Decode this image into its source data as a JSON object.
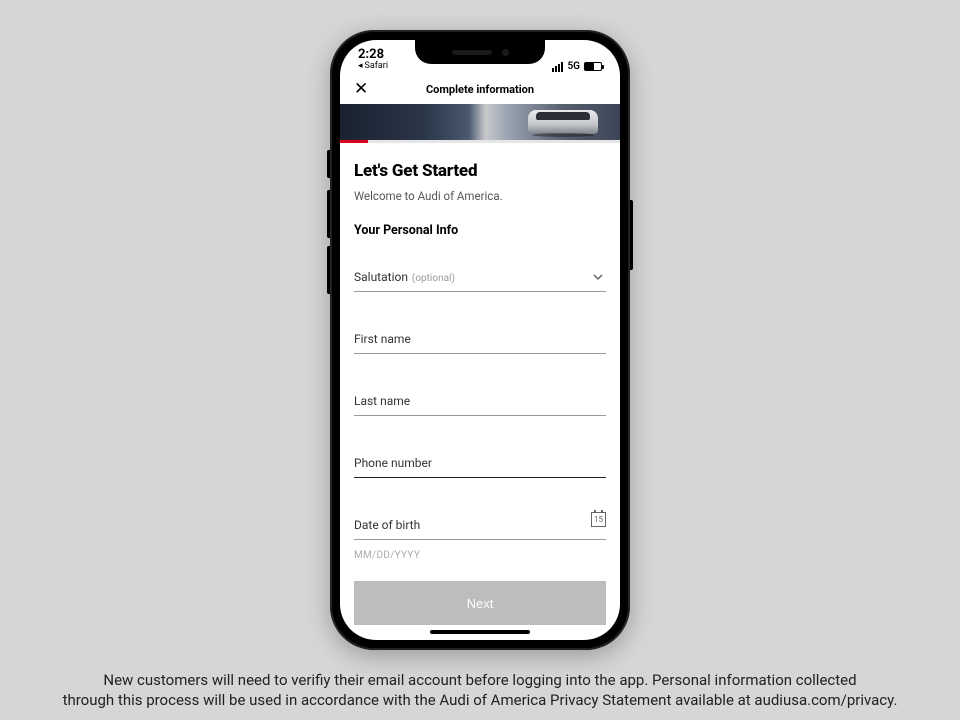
{
  "statusbar": {
    "time": "2:28",
    "back_app": "Safari",
    "network": "5G"
  },
  "navbar": {
    "title": "Complete information"
  },
  "page": {
    "title": "Let's Get Started",
    "subtitle": "Welcome to Audi of America.",
    "section_title": "Your Personal Info"
  },
  "fields": {
    "salutation": {
      "label": "Salutation",
      "hint": "(optional)"
    },
    "first_name": {
      "label": "First name"
    },
    "last_name": {
      "label": "Last name"
    },
    "phone": {
      "label": "Phone number"
    },
    "dob": {
      "label": "Date of birth",
      "placeholder": "MM/DD/YYYY",
      "icon_text": "15"
    }
  },
  "buttons": {
    "next": "Next"
  },
  "caption": {
    "line1": "New customers will need to verifiy their email account before logging into the app. Personal information collected",
    "line2": "through this process will be used in accordance with the Audi of America  Privacy Statement available at audiusa.com/privacy."
  }
}
